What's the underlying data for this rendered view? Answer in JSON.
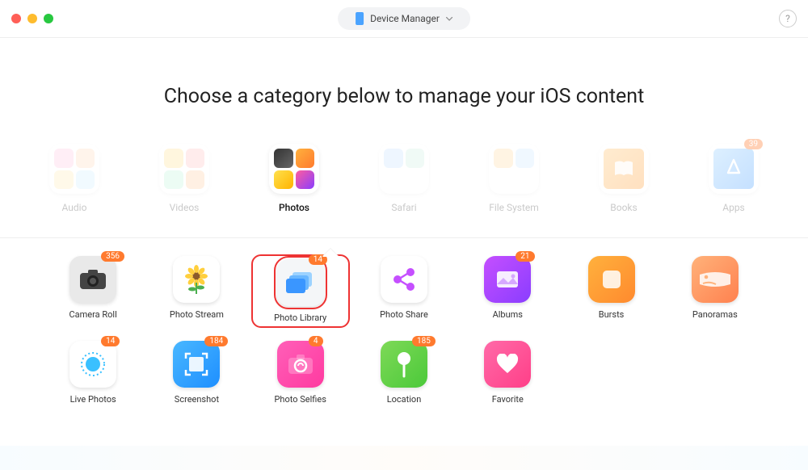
{
  "header": {
    "device_label": "Device Manager"
  },
  "headline": "Choose a category below to manage your iOS content",
  "categories": [
    {
      "key": "audio",
      "label": "Audio"
    },
    {
      "key": "videos",
      "label": "Videos"
    },
    {
      "key": "photos",
      "label": "Photos",
      "active": true
    },
    {
      "key": "safari",
      "label": "Safari"
    },
    {
      "key": "filesystem",
      "label": "File System"
    },
    {
      "key": "books",
      "label": "Books"
    },
    {
      "key": "apps",
      "label": "Apps",
      "badge": "39"
    }
  ],
  "sub_items": [
    {
      "key": "camera-roll",
      "label": "Camera Roll",
      "badge": "356"
    },
    {
      "key": "photo-stream",
      "label": "Photo Stream"
    },
    {
      "key": "photo-library",
      "label": "Photo Library",
      "badge": "14",
      "highlight": true
    },
    {
      "key": "photo-share",
      "label": "Photo Share"
    },
    {
      "key": "albums",
      "label": "Albums",
      "badge": "21"
    },
    {
      "key": "bursts",
      "label": "Bursts"
    },
    {
      "key": "panoramas",
      "label": "Panoramas"
    },
    {
      "key": "live-photos",
      "label": "Live Photos",
      "badge": "14"
    },
    {
      "key": "screenshot",
      "label": "Screenshot",
      "badge": "184"
    },
    {
      "key": "photo-selfies",
      "label": "Photo Selfies",
      "badge": "4"
    },
    {
      "key": "location",
      "label": "Location",
      "badge": "185"
    },
    {
      "key": "favorite",
      "label": "Favorite"
    }
  ]
}
